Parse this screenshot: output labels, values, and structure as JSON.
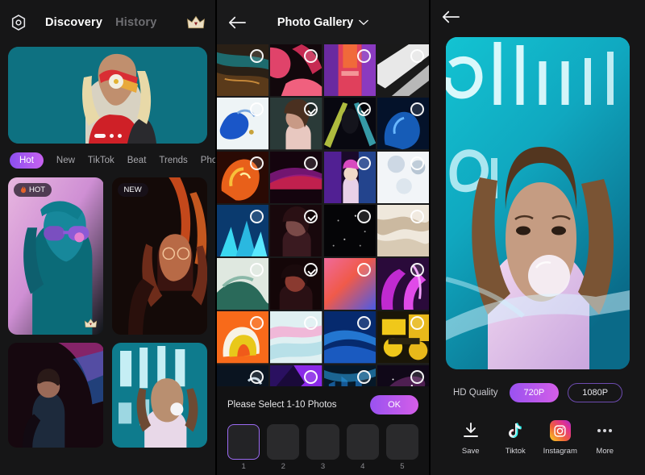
{
  "discovery": {
    "settings_icon": "gear-icon",
    "crown_icon": "crown-icon",
    "tabs": [
      {
        "label": "Discovery",
        "active": true
      },
      {
        "label": "History",
        "active": false
      }
    ],
    "banner": {
      "alt": "woman in sunglasses on teal background",
      "dots": 3,
      "active_dot": 0
    },
    "categories": [
      {
        "label": "Hot",
        "active": true
      },
      {
        "label": "New",
        "active": false
      },
      {
        "label": "TikTok",
        "active": false
      },
      {
        "label": "Beat",
        "active": false
      },
      {
        "label": "Trends",
        "active": false
      },
      {
        "label": "Pho",
        "active": false
      }
    ],
    "cards": [
      {
        "badge": "HOT",
        "badge_icon": "flame-icon",
        "crown": true
      },
      {
        "badge": "NEW",
        "badge_icon": "",
        "crown": false
      },
      {
        "badge": "",
        "badge_icon": "",
        "crown": false
      },
      {
        "badge": "",
        "badge_icon": "",
        "crown": false
      }
    ]
  },
  "gallery": {
    "back_icon": "back-arrow-icon",
    "title": "Photo Gallery",
    "dropdown_icon": "chevron-down-icon",
    "columns": 4,
    "cells": [
      {
        "selected": false
      },
      {
        "selected": false
      },
      {
        "selected": false
      },
      {
        "selected": false
      },
      {
        "selected": false
      },
      {
        "selected": true
      },
      {
        "selected": true
      },
      {
        "selected": false
      },
      {
        "selected": false
      },
      {
        "selected": false
      },
      {
        "selected": false
      },
      {
        "selected": false
      },
      {
        "selected": false
      },
      {
        "selected": true
      },
      {
        "selected": false
      },
      {
        "selected": false
      },
      {
        "selected": false
      },
      {
        "selected": true
      },
      {
        "selected": false
      },
      {
        "selected": false
      },
      {
        "selected": false
      },
      {
        "selected": false
      },
      {
        "selected": false
      },
      {
        "selected": false
      },
      {
        "selected": false
      },
      {
        "selected": false
      },
      {
        "selected": false
      },
      {
        "selected": false
      },
      {
        "selected": false
      },
      {
        "selected": false
      },
      {
        "selected": false
      },
      {
        "selected": false
      }
    ],
    "sheet": {
      "prompt": "Please Select 1-10 Photos",
      "ok_label": "OK",
      "slots": [
        {
          "number": "1",
          "active": true
        },
        {
          "number": "2",
          "active": false
        },
        {
          "number": "3",
          "active": false
        },
        {
          "number": "4",
          "active": false
        },
        {
          "number": "5",
          "active": false
        }
      ]
    }
  },
  "preview": {
    "back_icon": "back-arrow-icon",
    "image_alt": "woman blowing bubble gum with neon sign",
    "quality": {
      "label": "HD Quality",
      "options": [
        {
          "label": "720P",
          "active": true
        },
        {
          "label": "1080P",
          "active": false
        }
      ]
    },
    "share": [
      {
        "label": "Save",
        "icon": "download-icon"
      },
      {
        "label": "Tiktok",
        "icon": "tiktok-icon"
      },
      {
        "label": "Instagram",
        "icon": "instagram-icon"
      },
      {
        "label": "More",
        "icon": "more-dots-icon"
      }
    ]
  },
  "colors": {
    "accent_start": "#9a52f0",
    "accent_end": "#d45ee8",
    "background": "#161617",
    "sheet_bg": "#121213"
  }
}
